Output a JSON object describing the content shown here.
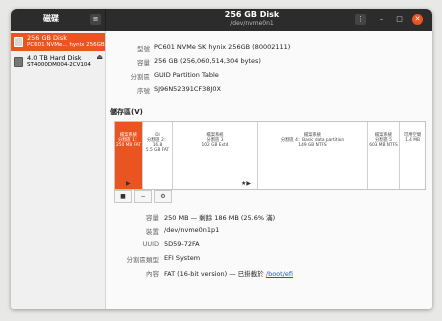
{
  "app": {
    "sidebar_title": "磁碟",
    "menu_icon": "hamburger-menu-icon",
    "window_title": "256 GB Disk",
    "window_subtitle": "/dev/nvme0n1",
    "kebab_icon": "kebab-menu-icon",
    "minimize_icon": "minimize-icon",
    "maximize_icon": "maximize-icon",
    "close_icon": "close-icon",
    "close_color": "#e95420"
  },
  "sidebar": {
    "disks": [
      {
        "name": "256 GB Disk",
        "model": "PC601 NVMe... hynix 256GB",
        "icon": "ssd-icon"
      },
      {
        "name": "4.0 TB Hard Disk",
        "model": "ST4000DM004-2CV104",
        "icon": "hard-disk-icon"
      }
    ]
  },
  "drive_info": [
    {
      "label": "型號",
      "value": "PC601 NVMe SK hynix 256GB (80002111)"
    },
    {
      "label": "容量",
      "value": "256 GB (256,060,514,304 bytes)"
    },
    {
      "label": "分割區",
      "value": "GUID Partition Table"
    },
    {
      "label": "序號",
      "value": "SJ96N52391CF38J0X"
    }
  ],
  "volumes": {
    "title": "儲存區(V)",
    "partitions": [
      {
        "text": "檔案系統\n分割區 1：\n250 MB FAT"
      },
      {
        "text": "Di\n分割區 2：16.8\n5.5 GB FAT"
      },
      {
        "text": "檔案系統\n分割區 3\n102 GB Ext4"
      },
      {
        "text": "檔案系統\n分割區 4：Basic data partition\n149 GB NTFS"
      },
      {
        "text": "檔案系統\n分割區 5\n603 MB NTFS"
      },
      {
        "text": "可用空間\n1.4 MB"
      }
    ],
    "accent": "#e95420"
  },
  "toolbar": {
    "stop_glyph": "■",
    "remove_glyph": "−",
    "settings_glyph": "⚙"
  },
  "details": [
    {
      "label": "容量",
      "value": "250 MB — 剩餘 186 MB (25.6% 滿)"
    },
    {
      "label": "裝置",
      "value": "/dev/nvme0n1p1"
    },
    {
      "label": "UUID",
      "value": "5D59-72FA"
    },
    {
      "label": "分割區類型",
      "value": "EFI System"
    },
    {
      "label": "內容",
      "value": "FAT (16-bit version) — 已掛載於",
      "link": "/boot/efi"
    }
  ]
}
